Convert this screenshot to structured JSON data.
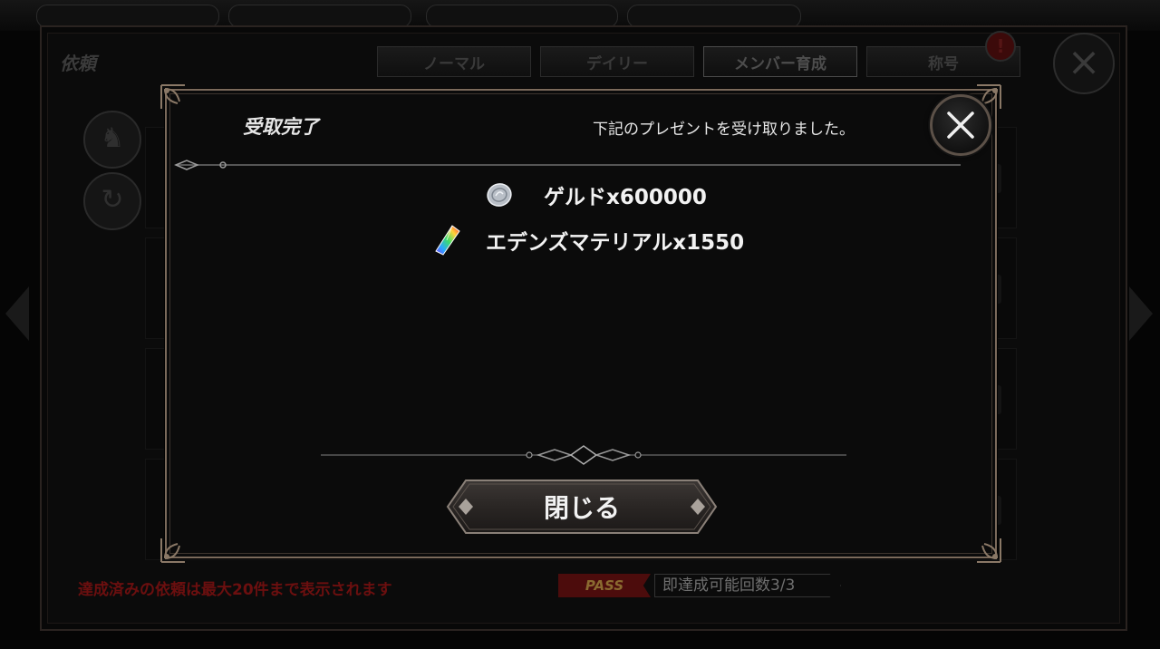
{
  "background": {
    "screen_title": "依頼",
    "tabs": [
      {
        "label": "ノーマル"
      },
      {
        "label": "デイリー"
      },
      {
        "label": "メンバー育成"
      },
      {
        "label": "称号"
      }
    ],
    "alert_badge": "!",
    "footer_note": "達成済みの依頼は最大20件まで表示されます",
    "pass_badge": "PASS",
    "instant_clear": "即達成可能回数3/3"
  },
  "modal": {
    "title": "受取完了",
    "message": "下記のプレゼントを受け取りました。",
    "rewards": [
      {
        "icon": "geld-coin-icon",
        "label": "ゲルドx600000"
      },
      {
        "icon": "eden-material-crystal-icon",
        "label": "エデンズマテリアルx1550"
      }
    ],
    "close_button_label": "閉じる"
  },
  "colors": {
    "modal_border": "#7b6a5b",
    "modal_bg": "#0b0b0b",
    "button_bg": "#2e2a28",
    "footer_note": "#6b0f0f",
    "pass_badge": "#4c0c0c"
  }
}
